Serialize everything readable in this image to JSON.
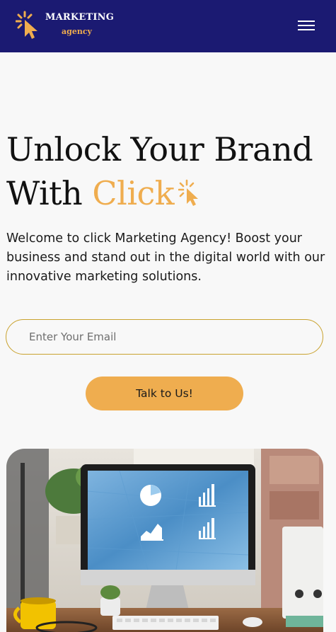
{
  "header": {
    "logo_title": "MARKETING",
    "logo_subtitle": "agency",
    "logo_icon": "cursor-click-icon",
    "menu_icon": "hamburger-menu-icon"
  },
  "hero": {
    "title_line1": "Unlock Your Brand",
    "title_line2_prefix": "With ",
    "title_accent": "Click",
    "title_icon": "cursor-click-icon",
    "description": "Welcome to click Marketing Agency! Boost your business and stand out in the digital world with our innovative marketing solutions."
  },
  "form": {
    "email_placeholder": "Enter Your Email",
    "email_value": "",
    "submit_label": "Talk to Us!"
  },
  "colors": {
    "navbar": "#1b1a72",
    "accent": "#efad4f",
    "background": "#f8f8f8",
    "input_border": "#c9a22e"
  }
}
